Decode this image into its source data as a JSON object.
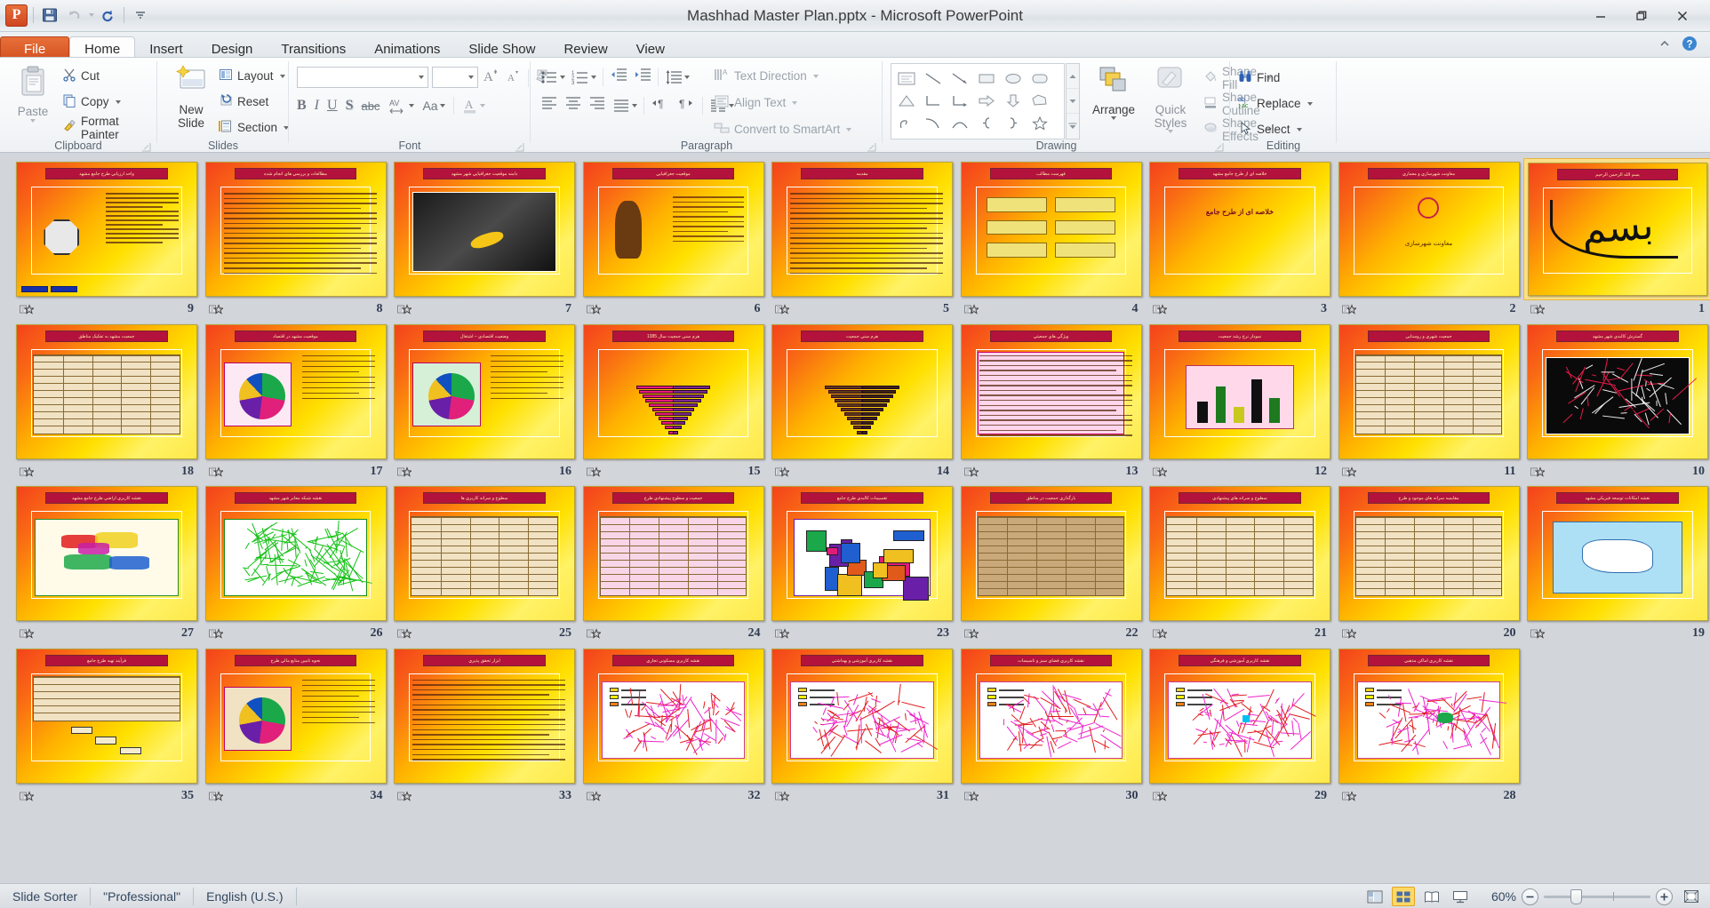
{
  "window": {
    "title": "Mashhad Master Plan.pptx  -  Microsoft PowerPoint",
    "app_logo": "P",
    "quick_access": [
      {
        "name": "save-icon",
        "label": "Save"
      },
      {
        "name": "undo-icon",
        "label": "Undo"
      },
      {
        "name": "redo-icon",
        "label": "Redo"
      },
      {
        "name": "customize-qat-icon",
        "label": "Customize Quick Access Toolbar"
      }
    ],
    "controls": [
      {
        "name": "minimize-button",
        "label": "Minimize"
      },
      {
        "name": "restore-button",
        "label": "Restore Down"
      },
      {
        "name": "close-button",
        "label": "Close"
      }
    ],
    "ribbon_controls": [
      {
        "name": "minimize-ribbon-button",
        "label": "Minimize the Ribbon"
      },
      {
        "name": "help-button",
        "label": "Help"
      }
    ]
  },
  "tabs": [
    {
      "label": "File",
      "active": false,
      "kind": "file"
    },
    {
      "label": "Home",
      "active": true,
      "kind": "normal"
    },
    {
      "label": "Insert",
      "active": false,
      "kind": "normal"
    },
    {
      "label": "Design",
      "active": false,
      "kind": "normal"
    },
    {
      "label": "Transitions",
      "active": false,
      "kind": "normal"
    },
    {
      "label": "Animations",
      "active": false,
      "kind": "normal"
    },
    {
      "label": "Slide Show",
      "active": false,
      "kind": "normal"
    },
    {
      "label": "Review",
      "active": false,
      "kind": "normal"
    },
    {
      "label": "View",
      "active": false,
      "kind": "normal"
    }
  ],
  "ribbon": {
    "groups": [
      {
        "label": "Clipboard"
      },
      {
        "label": "Slides"
      },
      {
        "label": "Font"
      },
      {
        "label": "Paragraph"
      },
      {
        "label": "Drawing"
      },
      {
        "label": "Editing"
      }
    ],
    "clipboard": {
      "paste": "Paste",
      "cut": "Cut",
      "copy": "Copy",
      "format_painter": "Format Painter"
    },
    "slides": {
      "new_slide": "New Slide",
      "layout": "Layout",
      "reset": "Reset",
      "section": "Section"
    },
    "font": {
      "font_name_value": "",
      "font_name_placeholder": "",
      "font_size_value": "",
      "grow_font": "A",
      "shrink_font": "A",
      "clear_formatting": "Clear All Formatting",
      "bold": "B",
      "italic": "I",
      "underline": "U",
      "shadow": "S",
      "strikethrough": "abc",
      "character_spacing": "AV",
      "change_case": "Aa",
      "font_color": "A"
    },
    "paragraph": {
      "bullets": "Bullets",
      "numbering": "Numbering",
      "decrease_indent": "Decrease List Level",
      "increase_indent": "Increase List Level",
      "line_spacing": "Line Spacing",
      "align_left": "Align Text Left",
      "center": "Center",
      "align_right": "Align Text Right",
      "justify": "Justify",
      "ltr": "Left-to-Right Text Direction",
      "rtl": "Right-to-Left Text Direction",
      "columns": "Columns",
      "text_direction": "Text Direction",
      "align_text": "Align Text",
      "convert_to_smartart": "Convert to SmartArt"
    },
    "drawing": {
      "shapes_gallery": "Shapes",
      "arrange": "Arrange",
      "quick_styles": "Quick Styles",
      "shape_fill": "Shape Fill",
      "shape_outline": "Shape Outline",
      "shape_effects": "Shape Effects"
    },
    "editing": {
      "find": "Find",
      "replace": "Replace",
      "select": "Select"
    }
  },
  "status_bar": {
    "view_name": "Slide Sorter",
    "theme": "\"Professional\"",
    "language": "English (U.S.)",
    "zoom_level": "60%",
    "view_buttons": [
      {
        "name": "view-normal",
        "label": "Normal",
        "active": false
      },
      {
        "name": "view-slide-sorter",
        "label": "Slide Sorter",
        "active": true
      },
      {
        "name": "view-reading",
        "label": "Reading View",
        "active": false
      },
      {
        "name": "view-slide-show",
        "label": "Slide Show",
        "active": false
      }
    ],
    "zoom_out": "Zoom Out",
    "zoom_in": "Zoom In",
    "fit_window": "Fit slide to current window"
  },
  "sorter": {
    "selected_slide": 1,
    "columns": 9,
    "slides": [
      {
        "num": "9",
        "kind": "text-clock",
        "title": "واحد ارزيابي طرح جامع مشهد"
      },
      {
        "num": "8",
        "kind": "text-dense",
        "title": "مطالعات و بررسي هاي انجام شده"
      },
      {
        "num": "7",
        "kind": "photo-dark",
        "title": "دامنه موقعيت جغرافيايي شهر مشهد"
      },
      {
        "num": "6",
        "kind": "figure-person",
        "title": "موقعيت جغرافيايي"
      },
      {
        "num": "5",
        "kind": "text-bullets",
        "title": "مقدمه"
      },
      {
        "num": "4",
        "kind": "boxes-list",
        "title": "فهرست مطالب"
      },
      {
        "num": "3",
        "kind": "big-title",
        "title": "خلاصه اي از طرح جامع مشهد"
      },
      {
        "num": "2",
        "kind": "logo-center",
        "title": "معاونت شهرسازي و معماري"
      },
      {
        "num": "1",
        "kind": "bismillah",
        "title": "بسم الله الرحمن الرحيم"
      },
      {
        "num": "18",
        "kind": "table",
        "title": "جمعيت مشهد به تفکيک مناطق"
      },
      {
        "num": "17",
        "kind": "pie-text",
        "title": "موقعيت مشهد در اقتصاد"
      },
      {
        "num": "16",
        "kind": "pie-green",
        "title": "وضعيت اقتصادي – اشتغال"
      },
      {
        "num": "15",
        "kind": "pyramid",
        "title": "هرم سني جمعيت سال 1385"
      },
      {
        "num": "14",
        "kind": "pyramid-brown",
        "title": "هرم سني جمعيت"
      },
      {
        "num": "13",
        "kind": "text-pink",
        "title": "ويژگي هاي جمعيتي"
      },
      {
        "num": "12",
        "kind": "bar-chart",
        "title": "نمودار نرخ رشد جمعيت"
      },
      {
        "num": "11",
        "kind": "table2",
        "title": "جمعيت شهري و روستايي"
      },
      {
        "num": "10",
        "kind": "map-red",
        "title": "گسترش کالبدي شهر مشهد"
      },
      {
        "num": "27",
        "kind": "map-color",
        "title": "نقشه کاربري اراضي طرح جامع مشهد"
      },
      {
        "num": "26",
        "kind": "map-green",
        "title": "نقشه شبکه معابر شهر مشهد"
      },
      {
        "num": "25",
        "kind": "table3",
        "title": "سطوح و سرانه کاربري ها"
      },
      {
        "num": "24",
        "kind": "table-pink",
        "title": "جمعيت و سطوح پيشنهادي طرح"
      },
      {
        "num": "23",
        "kind": "map-3d",
        "title": "تقسيمات کالبدي طرح جامع"
      },
      {
        "num": "22",
        "kind": "table-brown",
        "title": "بارگذاري جمعيت در مناطق"
      },
      {
        "num": "21",
        "kind": "table4",
        "title": "سطوح و سرانه هاي پيشنهادي"
      },
      {
        "num": "20",
        "kind": "table5",
        "title": "مقايسه سرانه هاي موجود و طرح"
      },
      {
        "num": "19",
        "kind": "map-blue",
        "title": "نقشه امکانات توسعه فيزيکي مشهد"
      },
      {
        "num": "35",
        "kind": "flow-table",
        "title": "فرآيند تهيه طرح جامع"
      },
      {
        "num": "34",
        "kind": "pie-table",
        "title": "نحوه تامين منابع مالي طرح"
      },
      {
        "num": "33",
        "kind": "text-table",
        "title": "ابزار تحقق پذيري"
      },
      {
        "num": "32",
        "kind": "map-pink1",
        "title": "نقشه کاربري مسکوني تجاري"
      },
      {
        "num": "31",
        "kind": "map-pink2",
        "title": "نقشه کاربري آموزشي و بهداشتي"
      },
      {
        "num": "30",
        "kind": "map-pink3",
        "title": "نقشه کاربري فضاي سبز و تاسيسات"
      },
      {
        "num": "29",
        "kind": "map-pink4",
        "title": "نقشه کاربري آموزشي و فرهنگي"
      },
      {
        "num": "28",
        "kind": "map-pink5",
        "title": "نقشه کاربري اماکن مذهبي"
      }
    ]
  },
  "colors": {
    "accent_orange": "#d24f1f",
    "selection_gold": "#fbe08b",
    "ribbon_bg": "#f4f6f8",
    "sorter_bg": "#d2d5d9",
    "status_bg": "#e0e4e8"
  }
}
